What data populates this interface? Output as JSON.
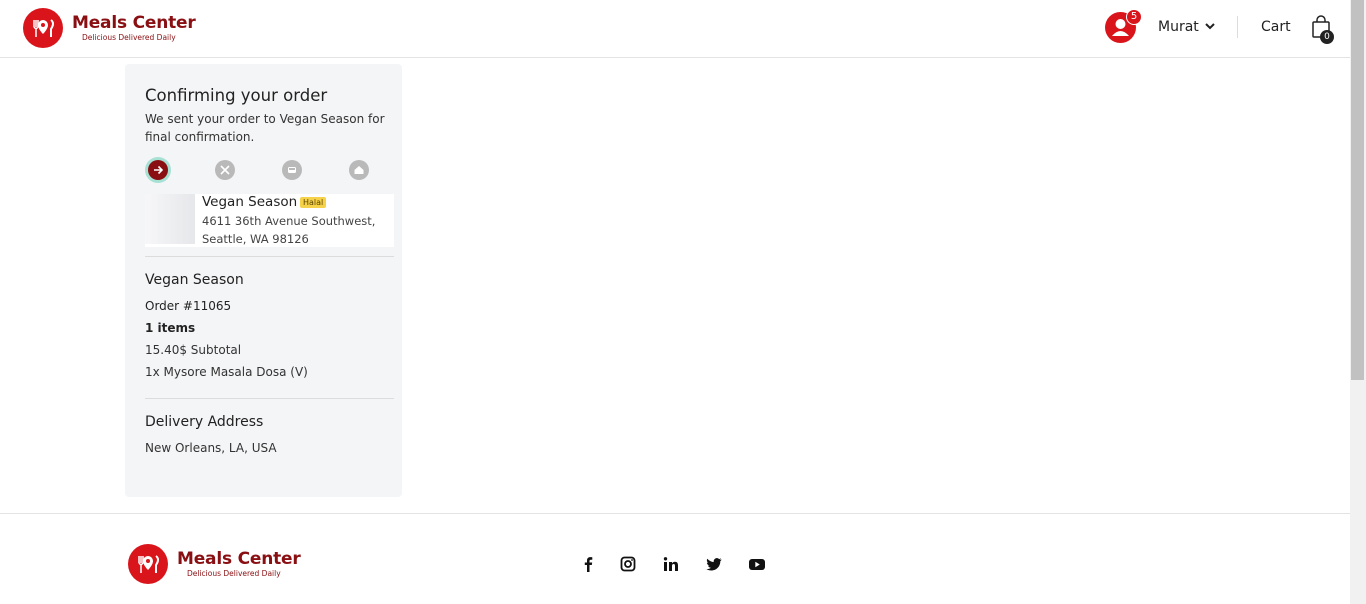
{
  "brand": {
    "name": "Meals Center",
    "tagline": "Delicious Delivered Daily",
    "color": "#8a0f12",
    "accent": "#d9151b"
  },
  "header": {
    "notifications_count": "5",
    "user_name": "Murat",
    "cart_label": "Cart",
    "cart_count": "0"
  },
  "order_card": {
    "title": "Confirming your order",
    "description": "We sent your order to Vegan Season for final confirmation.",
    "steps": [
      {
        "icon": "arrow-right-icon",
        "state": "active"
      },
      {
        "icon": "utensils-icon",
        "state": "pending"
      },
      {
        "icon": "car-icon",
        "state": "pending"
      },
      {
        "icon": "home-icon",
        "state": "pending"
      }
    ],
    "restaurant": {
      "name": "Vegan Season",
      "tag": "Halal",
      "address": "4611 36th Avenue Southwest, Seattle, WA 98126"
    },
    "summary": {
      "restaurant_name": "Vegan Season",
      "order_number": "Order #11065",
      "items_count": "1 items",
      "subtotal": "15.40$ Subtotal",
      "item_line": "1x Mysore Masala Dosa (V)"
    },
    "delivery": {
      "title": "Delivery Address",
      "address": "New Orleans, LA, USA"
    }
  },
  "footer": {
    "brand_name": "Meals Center",
    "tagline": "Delicious Delivered Daily",
    "social": [
      "facebook-icon",
      "instagram-icon",
      "linkedin-icon",
      "twitter-icon",
      "youtube-icon"
    ]
  }
}
